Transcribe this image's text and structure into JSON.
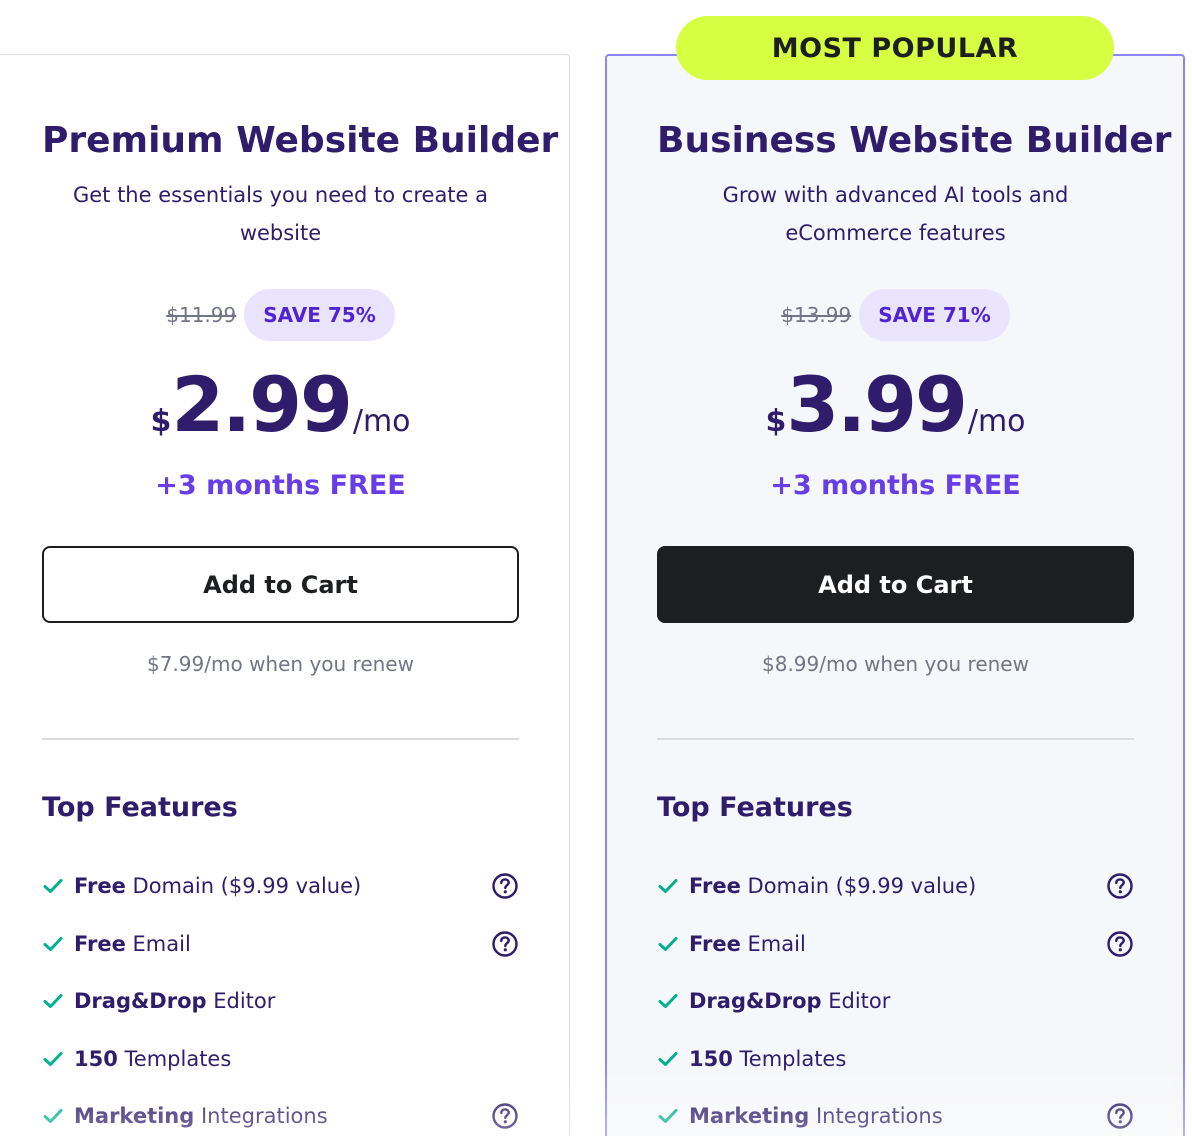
{
  "colors": {
    "brand_purple": "#673de6",
    "title_navy": "#2f1c6a",
    "popular_badge": "#d5ff40",
    "check_green": "#00b090",
    "button_dark": "#1d1e20",
    "highlight_border": "#8c85ff"
  },
  "plans": [
    {
      "title": "Premium Website Builder",
      "description": "Get the essentials you need to create a website",
      "old_price": "$11.99",
      "save_badge": "SAVE 75%",
      "currency": "$",
      "price": "2.99",
      "period": "/mo",
      "bonus": "+3 months FREE",
      "cta_label": "Add to Cart",
      "renew_text": "$7.99/mo when you renew",
      "features_heading": "Top Features",
      "features": [
        {
          "bold": "Free",
          "rest": " Domain ($9.99 value)",
          "help": true
        },
        {
          "bold": "Free",
          "rest": " Email",
          "help": true
        },
        {
          "bold": "Drag&Drop",
          "rest": " Editor",
          "help": false
        },
        {
          "bold": "150",
          "rest": " Templates",
          "help": false
        },
        {
          "bold": "Marketing",
          "rest": " Integrations",
          "help": true
        }
      ]
    },
    {
      "badge": "MOST POPULAR",
      "title": "Business Website Builder",
      "description": "Grow with advanced AI tools and eCommerce features",
      "old_price": "$13.99",
      "save_badge": "SAVE 71%",
      "currency": "$",
      "price": "3.99",
      "period": "/mo",
      "bonus": "+3 months FREE",
      "cta_label": "Add to Cart",
      "renew_text": "$8.99/mo when you renew",
      "features_heading": "Top Features",
      "features": [
        {
          "bold": "Free",
          "rest": " Domain ($9.99 value)",
          "help": true
        },
        {
          "bold": "Free",
          "rest": " Email",
          "help": true
        },
        {
          "bold": "Drag&Drop",
          "rest": " Editor",
          "help": false
        },
        {
          "bold": "150",
          "rest": " Templates",
          "help": false
        },
        {
          "bold": "Marketing",
          "rest": " Integrations",
          "help": true
        }
      ]
    }
  ],
  "icons": {
    "check": "check-icon",
    "help": "question-circle-icon"
  }
}
